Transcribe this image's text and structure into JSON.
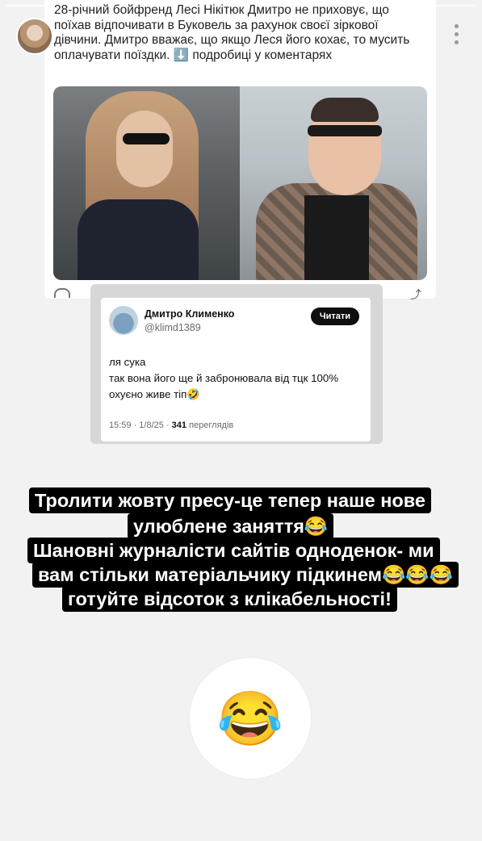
{
  "story": {
    "progress": 0.35
  },
  "news_post": {
    "text": "28-річний бойфренд Лесі Нікітюк Дмитро не приховує, що поїхав відпочивати в Буковель за рахунок своєї зіркової дівчини. Дмитро вважає, що якщо Леся його кохає, то мусить оплачувати поїздки. ⬇️ подробиці у коментарях"
  },
  "tweet": {
    "author_name": "Дмитро Клименко",
    "author_handle": "@klimd1389",
    "follow_label": "Читати",
    "lines": [
      "ля сука",
      "так вона його ще й забронювала від тцк 100%",
      "охуєно живе тіп🤣"
    ],
    "time_date": "15:59 · 1/8/25 ·",
    "views_count": "341",
    "views_label": "переглядів"
  },
  "caption": {
    "lines": [
      "Тролити жовту пресу-це тепер наше нове",
      "улюблене заняття😂",
      "Шановні журналісти сайтів одноденок- ми",
      "вам стільки матеріальчику підкинем😂😂😂",
      "готуйте відсоток з клікабельності!"
    ]
  },
  "reaction": {
    "emoji": "😂"
  },
  "icons": {
    "more": "more-vertical-icon",
    "avatar": "profile-avatar",
    "share": "share-icon",
    "reply": "reply-icon"
  }
}
